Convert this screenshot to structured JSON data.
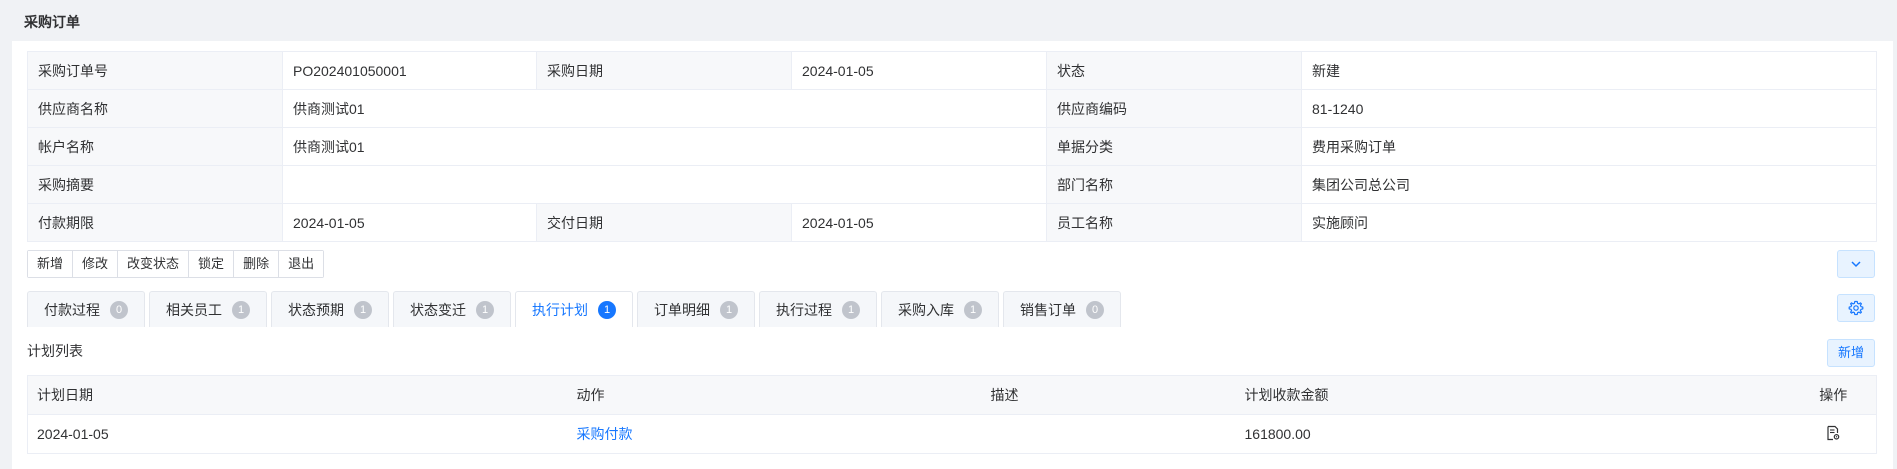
{
  "page": {
    "title": "采购订单"
  },
  "info": {
    "rows": [
      [
        {
          "label": "采购订单号",
          "value": "PO202401050001"
        },
        {
          "label": "采购日期",
          "value": "2024-01-05"
        },
        {
          "label": "状态",
          "value": "新建"
        }
      ],
      [
        {
          "label": "供应商名称",
          "value": "供商测试01"
        },
        {
          "label": "供应商编码",
          "value": "81-1240"
        }
      ],
      [
        {
          "label": "帐户名称",
          "value": "供商测试01"
        },
        {
          "label": "单据分类",
          "value": "费用采购订单"
        }
      ],
      [
        {
          "label": "采购摘要",
          "value": ""
        },
        {
          "label": "部门名称",
          "value": "集团公司总公司"
        }
      ],
      [
        {
          "label": "付款期限",
          "value": "2024-01-05"
        },
        {
          "label": "交付日期",
          "value": "2024-01-05"
        },
        {
          "label": "员工名称",
          "value": "实施顾问"
        }
      ]
    ]
  },
  "toolbar": {
    "buttons": [
      "新增",
      "修改",
      "改变状态",
      "锁定",
      "删除",
      "退出"
    ]
  },
  "tabs": [
    {
      "label": "付款过程",
      "count": "0"
    },
    {
      "label": "相关员工",
      "count": "1"
    },
    {
      "label": "状态预期",
      "count": "1"
    },
    {
      "label": "状态变迁",
      "count": "1"
    },
    {
      "label": "执行计划",
      "count": "1",
      "active": true
    },
    {
      "label": "订单明细",
      "count": "1"
    },
    {
      "label": "执行过程",
      "count": "1"
    },
    {
      "label": "采购入库",
      "count": "1"
    },
    {
      "label": "销售订单",
      "count": "0"
    }
  ],
  "plan": {
    "title": "计划列表",
    "add_label": "新增",
    "columns": [
      "计划日期",
      "动作",
      "描述",
      "计划收款金额",
      "操作"
    ],
    "rows": [
      {
        "date": "2024-01-05",
        "action": "采购付款",
        "desc": "",
        "amount": "161800.00"
      }
    ]
  },
  "colors": {
    "accent": "#1677ff",
    "label_bg": "#f7f8fa",
    "border": "#ebeef5",
    "badge_gray": "#c0c4cc"
  },
  "icons": {
    "collapse": "chevron-down-icon",
    "settings": "gear-icon",
    "row_operation": "document-view-icon"
  }
}
